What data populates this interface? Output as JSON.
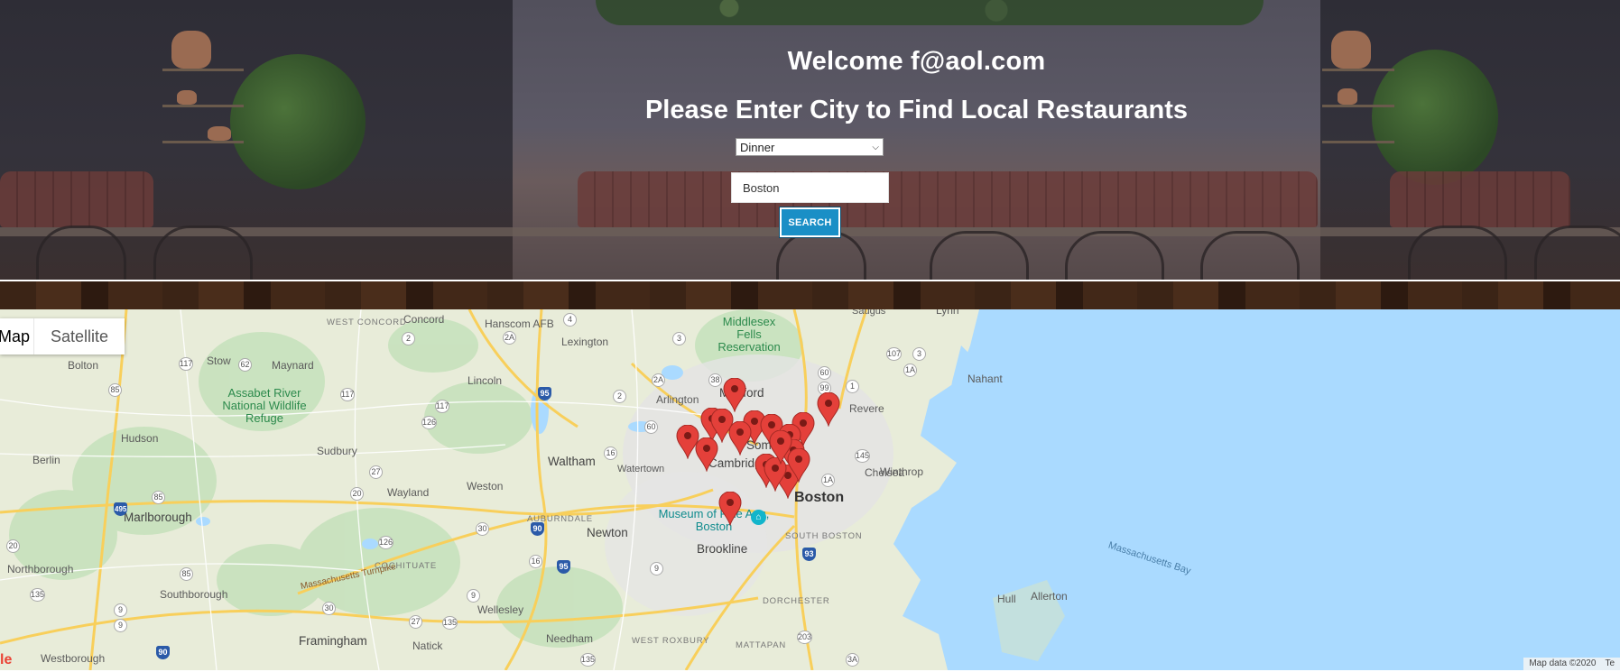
{
  "hero": {
    "welcome": "Welcome f@aol.com",
    "prompt": "Please Enter City to Find Local Restaurants",
    "meal_select": {
      "value": "Dinner"
    },
    "city_input": {
      "value": "Boston"
    },
    "search_label": "SEARCH"
  },
  "map": {
    "type_controls": {
      "map": "Map",
      "satellite": "Satellite"
    },
    "attribution": "Map data ©2020",
    "attribution_cut": "Te",
    "google_logo": "le",
    "labels": {
      "concord": "Concord",
      "west_concord": "WEST CONCORD",
      "hanscom": "Hanscom AFB",
      "lexington": "Lexington",
      "middlesex": "Middlesex Fells Reservation",
      "saugus": "Saugus",
      "lynn": "Lynn",
      "bolton": "Bolton",
      "stow": "Stow",
      "maynard": "Maynard",
      "lincoln": "Lincoln",
      "arlington": "Arlington",
      "medford": "Medford",
      "nahant": "Nahant",
      "revere": "Revere",
      "assabet": "Assabet River National Wildlife Refuge",
      "hudson": "Hudson",
      "berlin": "Berlin",
      "sudbury": "Sudbury",
      "waltham": "Waltham",
      "watertown": "Watertown",
      "cambridge": "Cambridge",
      "somerville": "Somerville",
      "winthrop": "Winthrop",
      "wayland": "Wayland",
      "weston": "Weston",
      "marlborough": "Marlborough",
      "auburndale": "AUBURNDALE",
      "newton": "Newton",
      "museum": "Museum of Fine Arts, Boston",
      "boston": "Boston",
      "south_boston": "SOUTH BOSTON",
      "brookline": "Brookline",
      "northborough": "Northborough",
      "cochituate": "COCHITUATE",
      "mass_pike": "Massachusetts Turnpike",
      "southborough": "Southborough",
      "wellesley": "Wellesley",
      "mass_bay": "Massachusetts Bay",
      "dorchester": "DORCHESTER",
      "hull": "Hull",
      "allerton": "Allerton",
      "westborough": "Westborough",
      "framingham": "Framingham",
      "natick": "Natick",
      "needham": "Needham",
      "west_roxbury": "WEST ROXBURY",
      "mattapan": "MATTAPAN",
      "chelsea": "Chelsea"
    },
    "routes": [
      "2",
      "2A",
      "4",
      "3",
      "107",
      "1A",
      "117",
      "62",
      "60",
      "1",
      "117",
      "95",
      "2",
      "2A",
      "99",
      "85",
      "126",
      "117",
      "38",
      "60",
      "145",
      "16",
      "1A",
      "27",
      "20",
      "93",
      "85",
      "495",
      "20",
      "30",
      "16",
      "90",
      "95",
      "90",
      "126",
      "9",
      "9",
      "85",
      "9",
      "135",
      "30",
      "27",
      "135",
      "135",
      "90",
      "203",
      "3A",
      "3",
      "9",
      "28"
    ]
  }
}
